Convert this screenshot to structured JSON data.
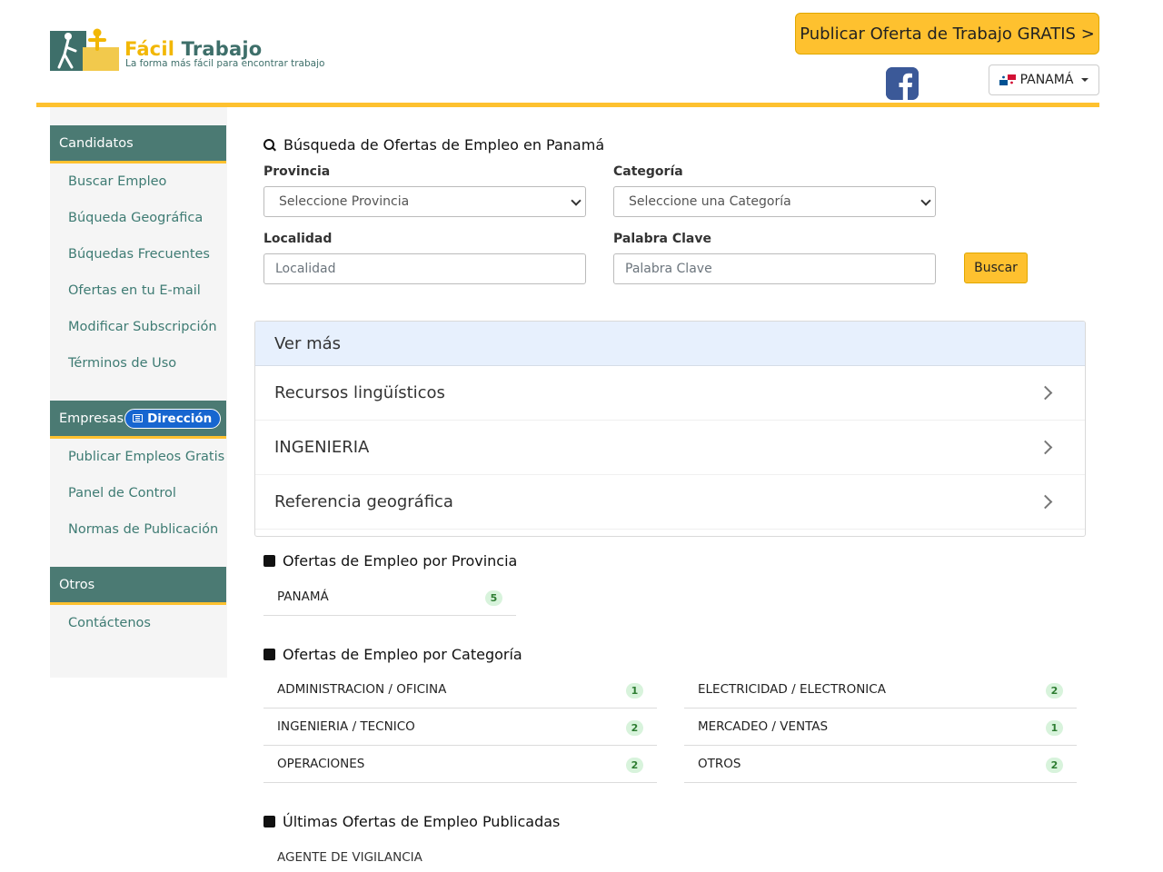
{
  "header": {
    "logo": {
      "name_part1": "Fácil",
      "name_part2": "Trabajo",
      "tagline": "La forma más fácil para encontrar trabajo"
    },
    "publish_button": "Publicar Oferta de Trabajo GRATIS >",
    "facebook_icon": "facebook-icon",
    "country_selector": "PANAMÁ",
    "accent_color": "#fec12f"
  },
  "sidebar": {
    "candidatos": {
      "title": "Candidatos",
      "items": [
        "Buscar Empleo",
        "Búqueda Geográfica",
        "Búquedas Frecuentes",
        "Ofertas en tu E-mail",
        "Modificar Subscripción",
        "Términos de Uso"
      ]
    },
    "empresas": {
      "title": "Empresas",
      "badge": "Dirección",
      "items": [
        "Publicar Empleos Gratis",
        "Panel de Control",
        "Normas de Publicación"
      ]
    },
    "otros": {
      "title": "Otros",
      "items": [
        "Contáctenos"
      ]
    },
    "header_color": "#4b7a73"
  },
  "search": {
    "title": "Búsqueda de Ofertas de Empleo en Panamá",
    "provincia": {
      "label": "Provincia",
      "value": "Seleccione Provincia"
    },
    "categoria": {
      "label": "Categoría",
      "value": "Seleccione una Categoría"
    },
    "localidad": {
      "label": "Localidad",
      "placeholder": "Localidad"
    },
    "palabra": {
      "label": "Palabra Clave",
      "placeholder": "Palabra Clave"
    },
    "button": "Buscar"
  },
  "ver_mas": {
    "title": "Ver más",
    "items": [
      "Recursos lingüísticos",
      "INGENIERIA",
      "Referencia geográfica"
    ]
  },
  "por_provincia": {
    "title": "Ofertas de Empleo por Provincia",
    "items": [
      {
        "name": "PANAMÁ",
        "count": "5"
      }
    ]
  },
  "por_categoria": {
    "title": "Ofertas de Empleo por Categoría",
    "left": [
      {
        "name": "ADMINISTRACION / OFICINA",
        "count": "1"
      },
      {
        "name": "INGENIERIA / TECNICO",
        "count": "2"
      },
      {
        "name": "OPERACIONES",
        "count": "2"
      }
    ],
    "right": [
      {
        "name": "ELECTRICIDAD / ELECTRONICA",
        "count": "2"
      },
      {
        "name": "MERCADEO / VENTAS",
        "count": "1"
      },
      {
        "name": "OTROS",
        "count": "2"
      }
    ]
  },
  "ultimas": {
    "title": "Últimas Ofertas de Empleo Publicadas",
    "items": [
      "AGENTE DE VIGILANCIA"
    ]
  }
}
